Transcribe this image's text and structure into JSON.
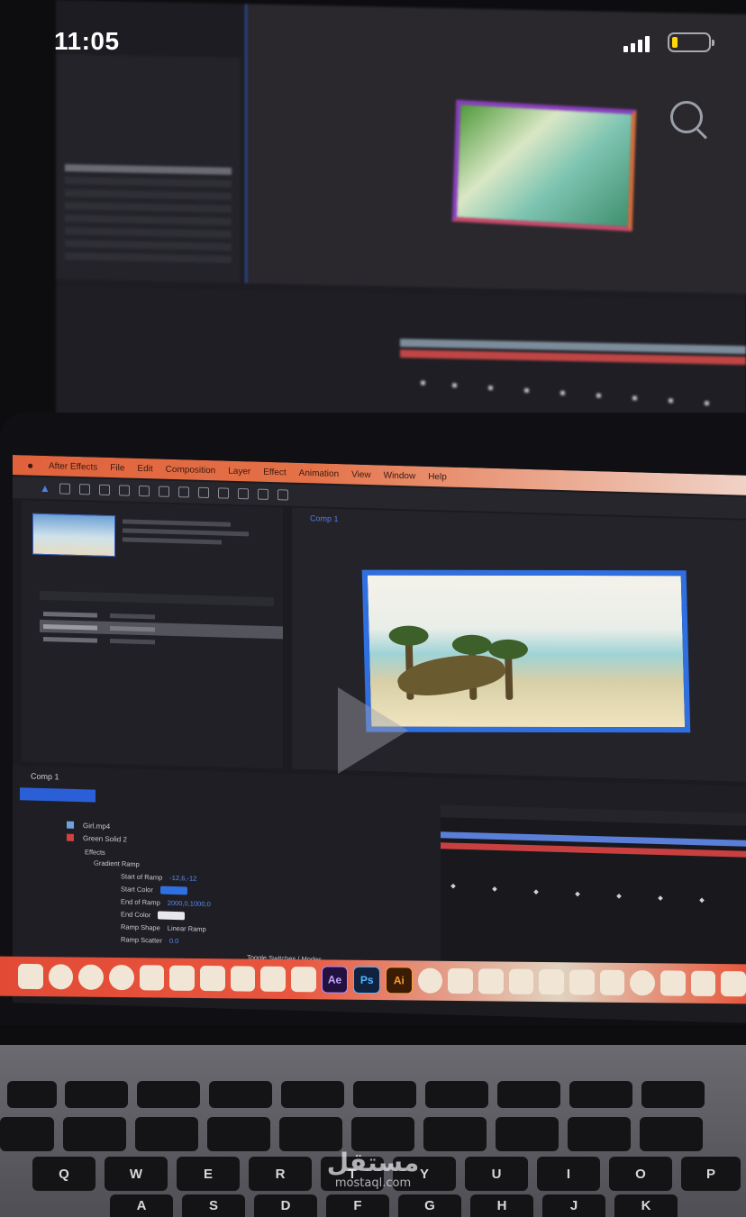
{
  "status_bar": {
    "time": "11:05",
    "battery_level": 0.15,
    "battery_color": "#ffd60a"
  },
  "menu_bar": {
    "items": [
      "After Effects",
      "File",
      "Edit",
      "Composition",
      "Layer",
      "Effect",
      "Animation",
      "View",
      "Window",
      "Help"
    ]
  },
  "viewer": {
    "tab_label": "Comp 1"
  },
  "timeline": {
    "tab_label": "Comp 1",
    "layers": [
      {
        "name": "Girl.mp4",
        "color": "#6fa0e0"
      },
      {
        "name": "Green Solid 2",
        "color": "#d24040"
      }
    ],
    "effect_group": "Effects",
    "effect_name": "Gradient Ramp",
    "properties": [
      {
        "label": "Start of Ramp",
        "value": "-12,6,-12"
      },
      {
        "label": "Start Color",
        "value": ""
      },
      {
        "label": "End of Ramp",
        "value": "2000,0,1000,0"
      },
      {
        "label": "End Color",
        "value": ""
      },
      {
        "label": "Ramp Shape",
        "value": "Linear Ramp"
      },
      {
        "label": "Ramp Scatter",
        "value": "0.0"
      }
    ],
    "footer_label": "Toggle Switches / Modes"
  },
  "dock": {
    "app_labels": [
      "Ae",
      "Ps",
      "Ai"
    ]
  },
  "keyboard": {
    "row_qwerty": [
      "Q",
      "W",
      "E",
      "R",
      "T",
      "Y",
      "U",
      "I",
      "O",
      "P"
    ],
    "row_asdf": [
      "A",
      "S",
      "D",
      "F",
      "G",
      "H",
      "J",
      "K"
    ]
  },
  "watermark": {
    "logo_text": "مستقل",
    "url": "mostaql.com"
  },
  "colors": {
    "accent_blue": "#2f6fe0",
    "menubar_orange": "#e0623c",
    "dock_red": "#e24a35"
  }
}
